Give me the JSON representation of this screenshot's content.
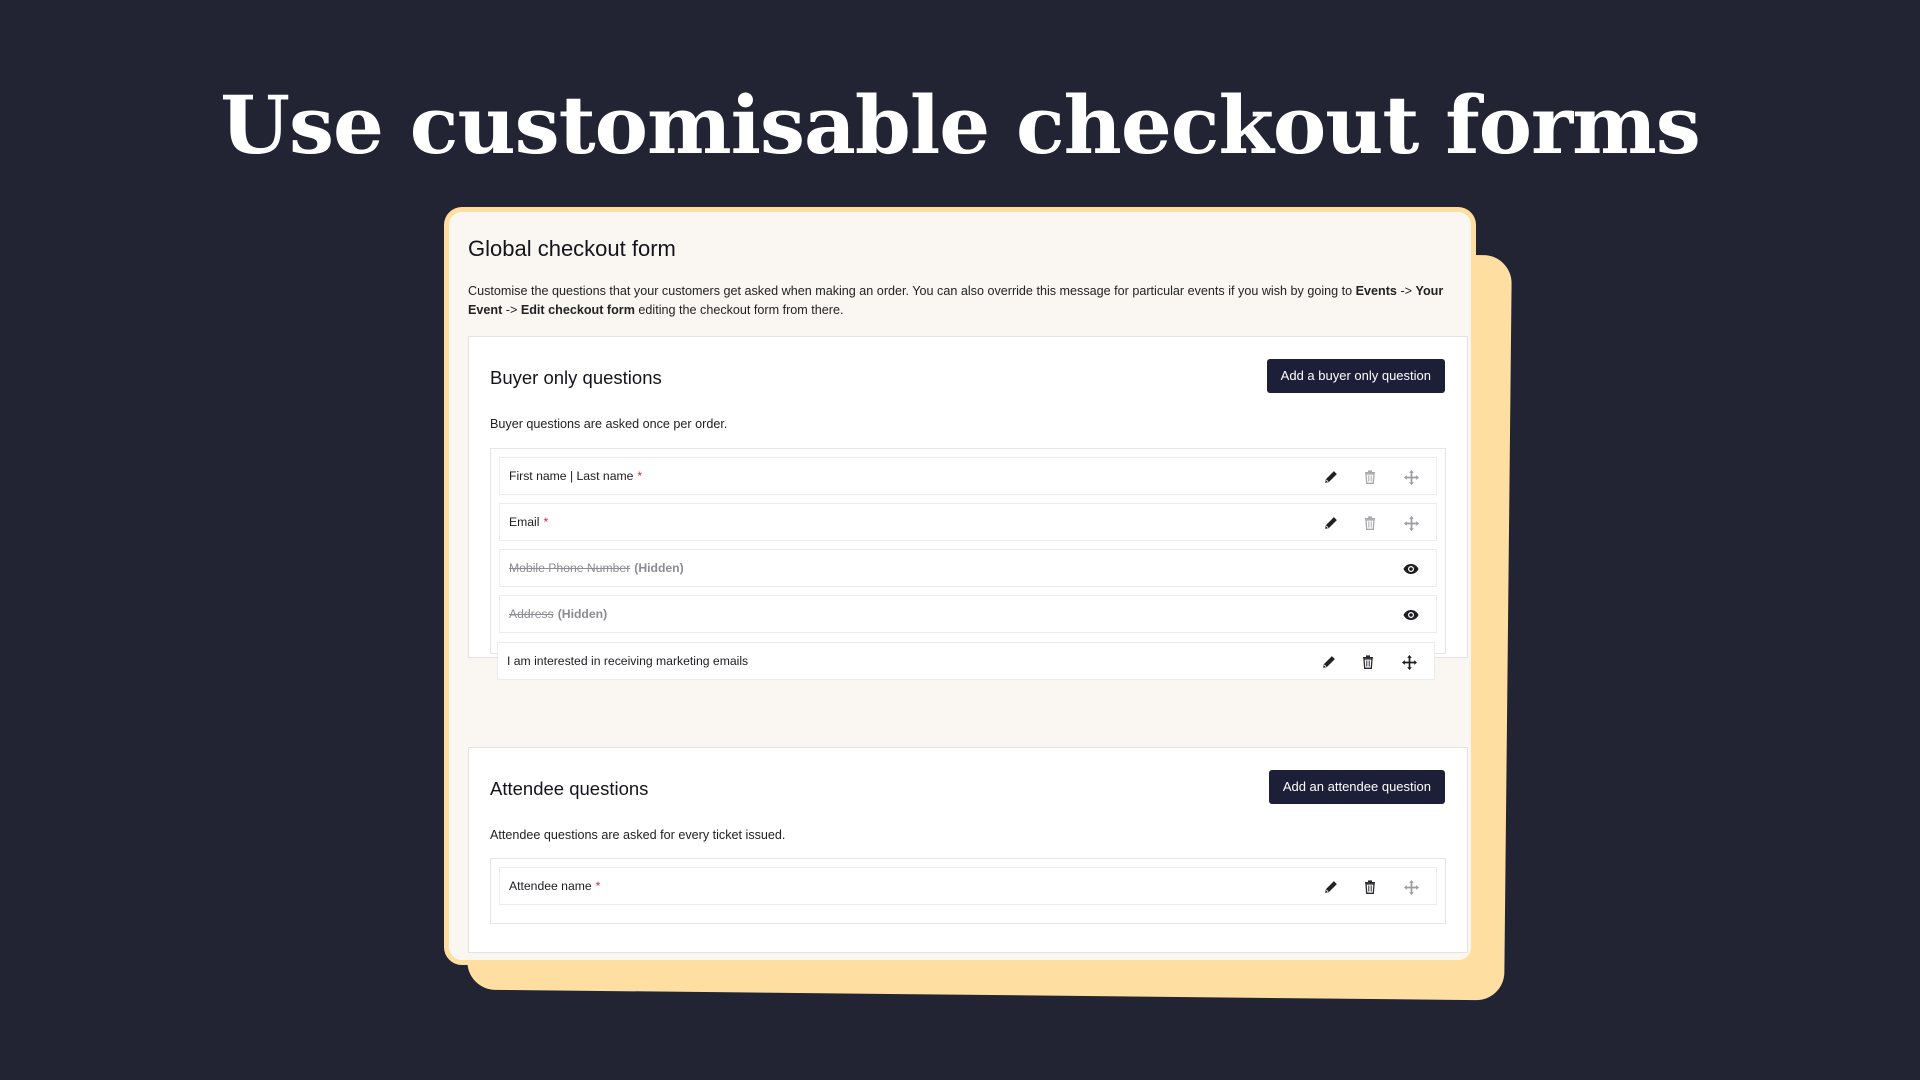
{
  "headline": "Use customisable checkout forms",
  "card": {
    "title": "Global checkout form",
    "description_part1": "Customise the questions that your customers get asked when making an order. You can also override this message for particular events if you wish by going to ",
    "events": "Events",
    "arrow1": " -> ",
    "your_event": "Your Event",
    "arrow2": " -> ",
    "edit_checkout_form": "Edit checkout form",
    "description_part2": " editing the checkout form from there."
  },
  "buyer": {
    "title": "Buyer only questions",
    "button": "Add a buyer only question",
    "description": "Buyer questions are asked once per order.",
    "rows": [
      {
        "label": "First name | Last name",
        "required": "*"
      },
      {
        "label": "Email",
        "required": "*"
      },
      {
        "label": "Mobile Phone Number",
        "hidden_tag": "(Hidden)"
      },
      {
        "label": "Address",
        "hidden_tag": "(Hidden)"
      },
      {
        "label": "I am interested in receiving marketing emails"
      }
    ]
  },
  "attendee": {
    "title": "Attendee questions",
    "button": "Add an attendee question",
    "description": "Attendee questions are asked for every ticket issued.",
    "rows": [
      {
        "label": "Attendee name",
        "required": "*"
      }
    ]
  },
  "colors": {
    "background": "#222433",
    "accent_card": "#ffdfa1",
    "button": "#1d1f38",
    "required": "#d02b2b"
  },
  "icons": {
    "edit": "pencil-icon",
    "delete": "trash-icon",
    "move": "move-icon",
    "show": "eye-icon"
  }
}
